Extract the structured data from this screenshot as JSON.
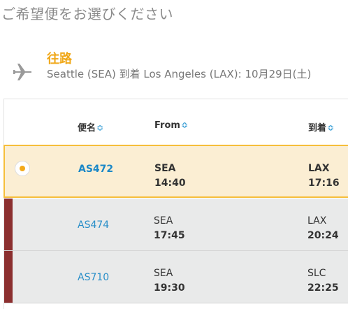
{
  "page": {
    "title": "ご希望便をお選びください"
  },
  "outbound": {
    "label": "往路",
    "route": "Seattle (SEA) 到着 Los Angeles (LAX): 10月29日(土)"
  },
  "table": {
    "headers": {
      "flight": "便名",
      "from": "From",
      "arrival": "到着"
    },
    "sort_glyph": "≎",
    "rows": [
      {
        "flight": "AS472",
        "from_code": "SEA",
        "from_time": "14:40",
        "to_code": "LAX",
        "to_time": "17:16",
        "selected": true
      },
      {
        "flight": "AS474",
        "from_code": "SEA",
        "from_time": "17:45",
        "to_code": "LAX",
        "to_time": "20:24",
        "selected": false
      },
      {
        "flight": "AS710",
        "from_code": "SEA",
        "from_time": "19:30",
        "to_code": "SLC",
        "to_time": "22:25",
        "selected": false
      }
    ]
  },
  "colors": {
    "accent": "#f0a81a",
    "link": "#2a8fc9",
    "unavailable_bar": "#8b2f2f",
    "selected_bg": "#fbeed3"
  }
}
